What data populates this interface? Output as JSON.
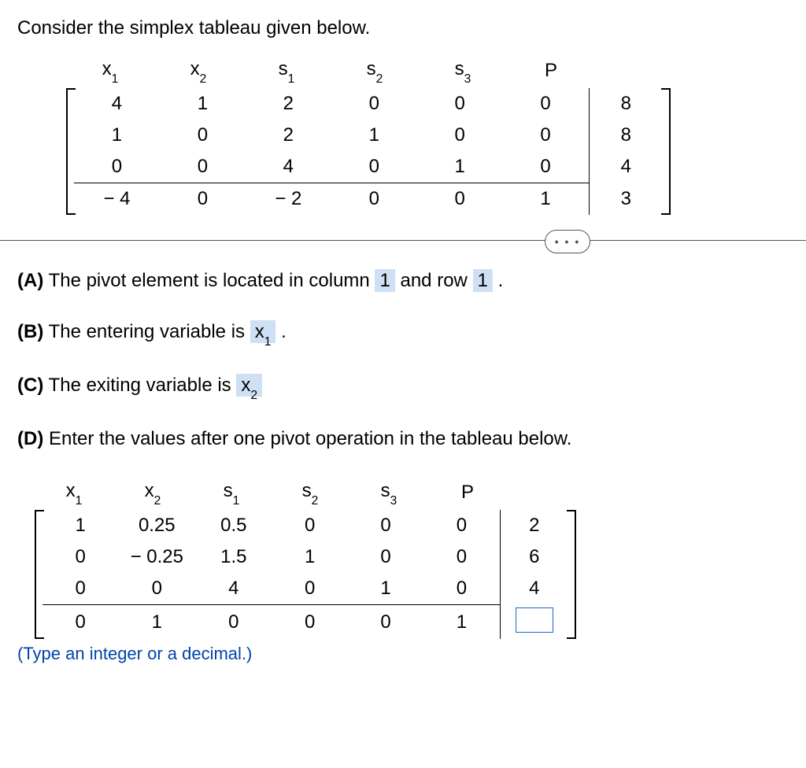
{
  "heading": "Consider the simplex tableau given below.",
  "cols": {
    "x1": "x",
    "x1s": "1",
    "x2": "x",
    "x2s": "2",
    "s1": "s",
    "s1s": "1",
    "s2": "s",
    "s2s": "2",
    "s3": "s",
    "s3s": "3",
    "P": "P"
  },
  "big": {
    "r1": [
      "4",
      "1",
      "2",
      "0",
      "0",
      "0",
      "8"
    ],
    "r2": [
      "1",
      "0",
      "2",
      "1",
      "0",
      "0",
      "8"
    ],
    "r3": [
      "0",
      "0",
      "4",
      "0",
      "1",
      "0",
      "4"
    ],
    "r4": [
      "− 4",
      "0",
      "− 2",
      "0",
      "0",
      "1",
      "3"
    ]
  },
  "partA": {
    "label": "(A)",
    "t1": "The pivot element is located in column ",
    "v1": "1",
    "t2": " and row ",
    "v2": "1",
    "t3": "."
  },
  "partB": {
    "label": "(B)",
    "t1": "The entering variable is ",
    "var": "x",
    "sub": "1",
    "t2": " ."
  },
  "partC": {
    "label": "(C)",
    "t1": "The exiting variable is ",
    "var": "x",
    "sub": "2"
  },
  "partD": {
    "label": "(D)",
    "t1": "Enter the values after one pivot operation in the tableau below."
  },
  "small": {
    "r1": [
      "1",
      "0.25",
      "0.5",
      "0",
      "0",
      "0",
      "2"
    ],
    "r2": [
      "0",
      "− 0.25",
      "1.5",
      "1",
      "0",
      "0",
      "6"
    ],
    "r3": [
      "0",
      "0",
      "4",
      "0",
      "1",
      "0",
      "4"
    ],
    "r4": [
      "0",
      "1",
      "0",
      "0",
      "0",
      "1"
    ]
  },
  "hint": "(Type an integer or a decimal.)",
  "expander": "• • •"
}
